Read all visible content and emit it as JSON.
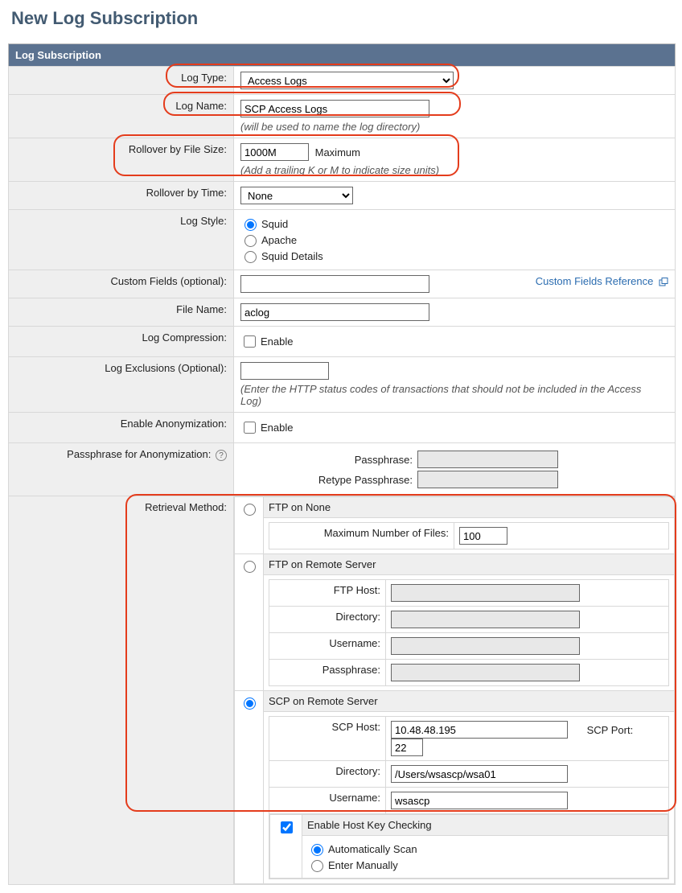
{
  "page": {
    "title": "New Log Subscription"
  },
  "section": {
    "header": "Log Subscription"
  },
  "log_type": {
    "label": "Log Type:",
    "selected": "Access Logs"
  },
  "log_name": {
    "label": "Log Name:",
    "value": "SCP Access Logs",
    "hint": "(will be used to name the log directory)"
  },
  "rollover_size": {
    "label": "Rollover by File Size:",
    "value": "1000M",
    "maxlabel": "Maximum",
    "hint": "(Add a trailing K or M to indicate size units)"
  },
  "rollover_time": {
    "label": "Rollover by Time:",
    "selected": "None"
  },
  "log_style": {
    "label": "Log Style:",
    "options": [
      "Squid",
      "Apache",
      "Squid Details"
    ],
    "selected": "Squid"
  },
  "custom_fields": {
    "label": "Custom Fields (optional):",
    "value": "",
    "ref": "Custom Fields Reference"
  },
  "file_name": {
    "label": "File Name:",
    "value": "aclog"
  },
  "compression": {
    "label": "Log Compression:",
    "enable": "Enable",
    "checked": false
  },
  "exclusions": {
    "label": "Log Exclusions (Optional):",
    "value": "",
    "hint": "(Enter the HTTP status codes of transactions that should not be included in the Access Log)"
  },
  "anonymization": {
    "label": "Enable Anonymization:",
    "enable": "Enable",
    "checked": false
  },
  "anon_pass": {
    "label": "Passphrase for Anonymization:",
    "pass_label": "Passphrase:",
    "retype_label": "Retype Passphrase:"
  },
  "retrieval": {
    "label": "Retrieval Method:",
    "ftp_none": {
      "title": "FTP on None",
      "maxfiles_label": "Maximum Number of Files:",
      "maxfiles": "100"
    },
    "ftp_remote": {
      "title": "FTP on Remote Server",
      "host_label": "FTP Host:",
      "host": "",
      "dir_label": "Directory:",
      "dir": "",
      "user_label": "Username:",
      "user": "",
      "pass_label": "Passphrase:",
      "pass": ""
    },
    "scp": {
      "title": "SCP on Remote Server",
      "host_label": "SCP Host:",
      "host": "10.48.48.195",
      "port_label": "SCP Port:",
      "port": "22",
      "dir_label": "Directory:",
      "dir": "/Users/wsascp/wsa01",
      "user_label": "Username:",
      "user": "wsascp",
      "hostkey_label": "Enable Host Key Checking",
      "hostkey_checked": true,
      "auto_label": "Automatically Scan",
      "manual_label": "Enter Manually",
      "auto_selected": true
    },
    "selected": "scp"
  }
}
